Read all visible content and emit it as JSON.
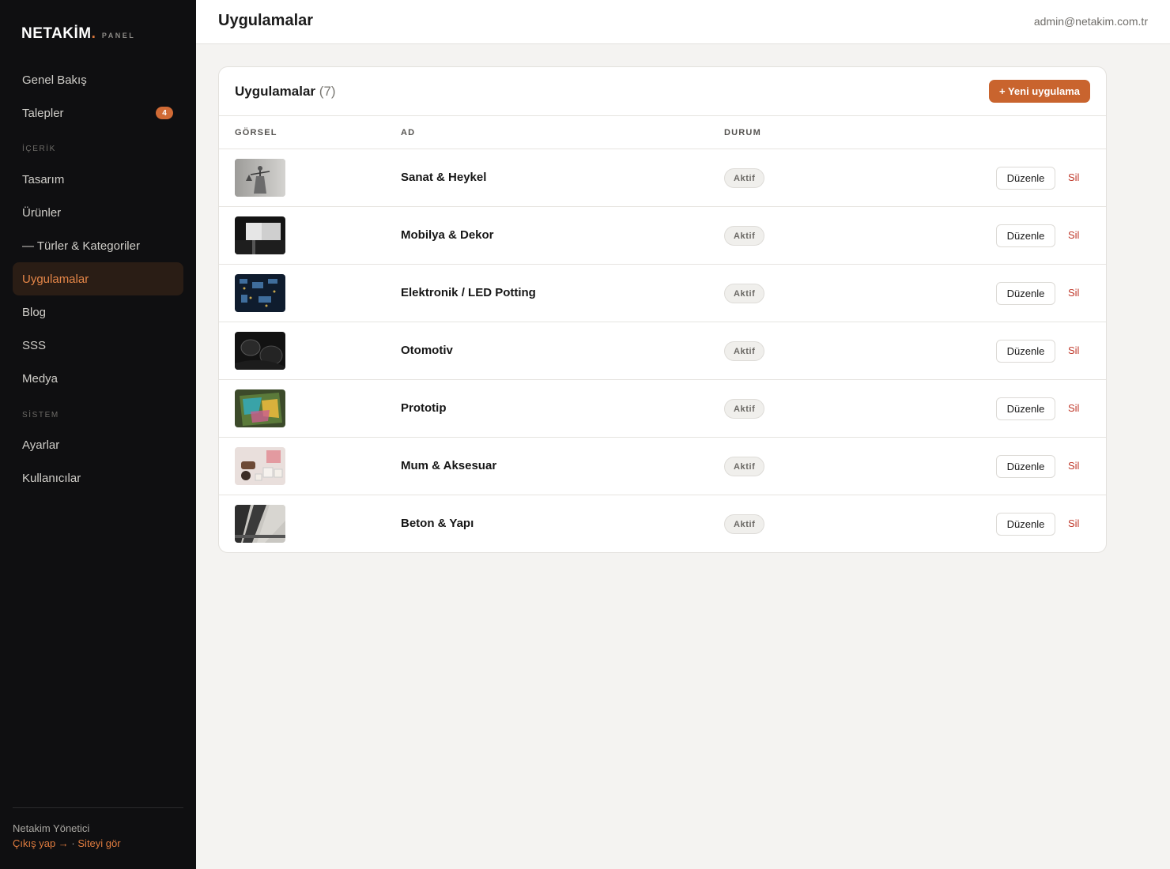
{
  "brand": {
    "name": "NETAKİM",
    "dot": ".",
    "sub": "PANEL",
    "accent": "#d9773d"
  },
  "sidebar": {
    "items": [
      {
        "label": "Genel Bakış"
      },
      {
        "label": "Talepler",
        "badge": "4"
      },
      {
        "label": "Tasarım"
      },
      {
        "label": "Ürünler"
      },
      {
        "label": "— Türler & Kategoriler"
      },
      {
        "label": "Uygulamalar",
        "active": true
      },
      {
        "label": "Blog"
      },
      {
        "label": "SSS"
      },
      {
        "label": "Medya"
      },
      {
        "label": "Ayarlar"
      },
      {
        "label": "Kullanıcılar"
      }
    ],
    "sections": {
      "content": "İÇERİK",
      "system": "SİSTEM"
    },
    "user": "Netakim Yönetici",
    "logout": "Çıkış yap →",
    "separator": "·",
    "view_site": "Siteyi gör"
  },
  "topbar": {
    "title": "Uygulamalar",
    "email": "admin@netakim.com.tr"
  },
  "card": {
    "title": "Uygulamalar",
    "count": "(7)",
    "new_button": "+ Yeni uygulama",
    "columns": [
      "GÖRSEL",
      "AD",
      "DURUM"
    ],
    "edit_label": "Düzenle",
    "delete_label": "Sil",
    "rows": [
      {
        "name": "Sanat & Heykel",
        "status": "Aktif",
        "image": "statue-image"
      },
      {
        "name": "Mobilya & Dekor",
        "status": "Aktif",
        "image": "furniture-image"
      },
      {
        "name": "Elektronik / LED Potting",
        "status": "Aktif",
        "image": "circuit-board-image"
      },
      {
        "name": "Otomotiv",
        "status": "Aktif",
        "image": "car-interior-image"
      },
      {
        "name": "Prototip",
        "status": "Aktif",
        "image": "resin-prototype-image"
      },
      {
        "name": "Mum & Aksesuar",
        "status": "Aktif",
        "image": "candle-image"
      },
      {
        "name": "Beton & Yapı",
        "status": "Aktif",
        "image": "concrete-image"
      }
    ]
  },
  "colors": {
    "primary": "#c9642e",
    "danger": "#c0392b",
    "sidebar_bg": "#0f0f11",
    "active_bg": "#2a1d15"
  }
}
